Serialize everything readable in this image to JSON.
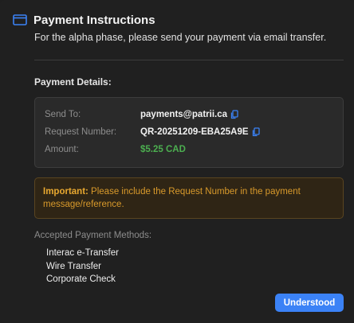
{
  "header": {
    "title": "Payment Instructions",
    "subtitle": "For the alpha phase, please send your payment via email transfer.",
    "icon": "credit-card-icon"
  },
  "details": {
    "section_title": "Payment Details:",
    "send_to_label": "Send To:",
    "send_to_value": "payments@patrii.ca",
    "request_label": "Request Number:",
    "request_value": "QR-20251209-EBA25A9E",
    "amount_label": "Amount:",
    "amount_value": "$5.25 CAD"
  },
  "warning": {
    "prefix": "Important:",
    "text": " Please include the Request Number in the payment message/reference."
  },
  "methods": {
    "title": "Accepted Payment Methods:",
    "items": [
      "Interac e-Transfer",
      "Wire Transfer",
      "Corporate Check"
    ]
  },
  "actions": {
    "understood_label": "Understood"
  },
  "colors": {
    "accent": "#3b82f6",
    "amount": "#4caf50",
    "warning": "#d99a2b"
  }
}
